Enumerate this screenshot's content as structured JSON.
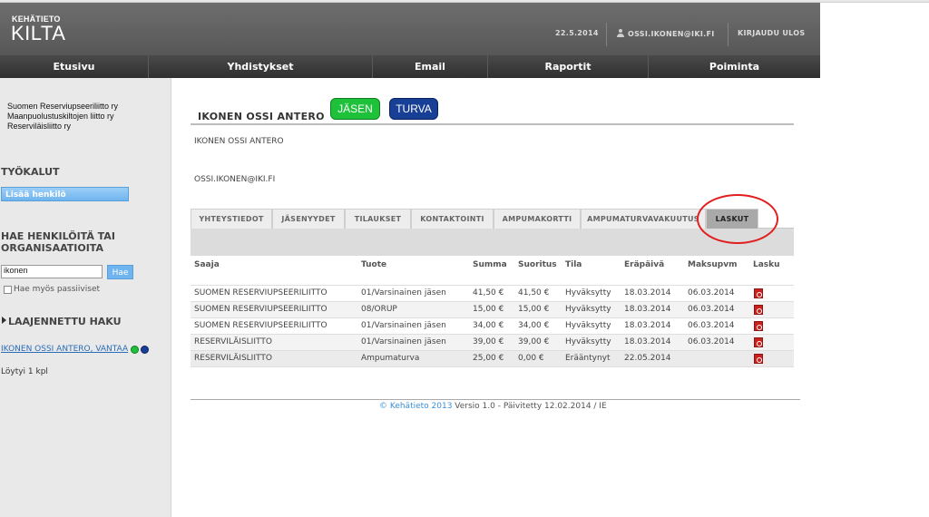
{
  "header": {
    "logo_small": "KEHÄTIETO",
    "logo_big": "KILTA",
    "date": "22.5.2014",
    "user_email": "OSSI.IKONEN@IKI.FI",
    "logout": "KIRJAUDU ULOS"
  },
  "nav": [
    "Etusivu",
    "Yhdistykset",
    "Email",
    "Raportit",
    "Poiminta"
  ],
  "sidebar": {
    "orgs": [
      "Suomen Reserviupseeriliitto ry",
      "Maanpuolustuskiltojen liitto ry",
      "Reserviläisliitto ry"
    ],
    "tools_title": "TYÖKALUT",
    "add_person": "Lisää henkilö",
    "search_title_1": "HAE HENKILÖITÄ TAI",
    "search_title_2": "ORGANISAATIOITA",
    "search_value": "ikonen",
    "search_button": "Hae",
    "passive_label": "Hae myös passiiviset",
    "advanced_search": "LAAJENNETTU HAKU",
    "result_link": "IKONEN OSSI ANTERO, VANTAA",
    "found_count": "Löytyi 1 kpl",
    "status_colors": [
      "#1ec23a",
      "#173f96"
    ]
  },
  "person": {
    "name_title": "IKONEN OSSI ANTERO",
    "badge_member": "JÄSEN",
    "badge_member_color": "#1ec23a",
    "badge_turva": "TURVA",
    "badge_turva_color": "#173f96",
    "name_line": "IKONEN OSSI ANTERO",
    "email_line": "OSSI.IKONEN@IKI.FI"
  },
  "tabs": [
    "YHTEYSTIEDOT",
    "JÄSENYYDET",
    "TILAUKSET",
    "KONTAKTOINTI",
    "AMPUMAKORTTI",
    "AMPUMATURVAVAKUUTUS",
    "LASKUT"
  ],
  "active_tab": "LASKUT",
  "table": {
    "headers": [
      "Saaja",
      "Tuote",
      "Summa",
      "Suoritus",
      "Tila",
      "Eräpäivä",
      "Maksupvm",
      "Lasku"
    ],
    "rows": [
      [
        "SUOMEN RESERVIUPSEERILIITTO",
        "01/Varsinainen jäsen",
        "41,50 €",
        "41,50 €",
        "Hyväksytty",
        "18.03.2014",
        "06.03.2014"
      ],
      [
        "SUOMEN RESERVIUPSEERILIITTO",
        "08/ORUP",
        "15,00 €",
        "15,00 €",
        "Hyväksytty",
        "18.03.2014",
        "06.03.2014"
      ],
      [
        "SUOMEN RESERVIUPSEERILIITTO",
        "01/Varsinainen jäsen",
        "34,00 €",
        "34,00 €",
        "Hyväksytty",
        "18.03.2014",
        "06.03.2014"
      ],
      [
        "RESERVILÄISLIITTO",
        "01/Varsinainen jäsen",
        "39,00 €",
        "39,00 €",
        "Hyväksytty",
        "18.03.2014",
        "06.03.2014"
      ],
      [
        "RESERVILÄISLIITTO",
        "Ampumaturva",
        "25,00 €",
        "0,00 €",
        "Erääntynyt",
        "22.05.2014",
        ""
      ]
    ],
    "invoice_icon": "pdf-icon"
  },
  "footer": {
    "copyright": "© Kehätieto 2013",
    "version": " Versio 1.0 - Päivitetty 12.02.2014 / IE"
  }
}
